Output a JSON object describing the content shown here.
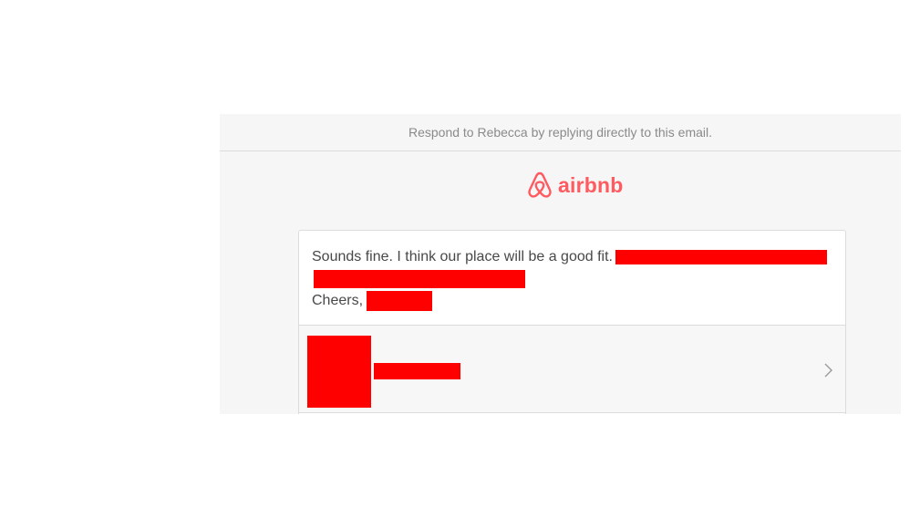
{
  "header": {
    "respond_text": "Respond to Rebecca by replying directly to this email."
  },
  "logo": {
    "wordmark": "airbnb",
    "icon": "airbnb-belo-icon",
    "color": "#ff5a5f"
  },
  "message": {
    "body_text": "Sounds fine. I think our place will be a good fit.",
    "signoff": "Cheers,"
  },
  "profile": {
    "icon": "chevron-right-icon"
  },
  "colors": {
    "background": "#f6f6f6",
    "card": "#ffffff",
    "text": "#484848",
    "muted": "#8a8a8a",
    "brand": "#ff5a5f",
    "redaction": "#ff0000"
  }
}
